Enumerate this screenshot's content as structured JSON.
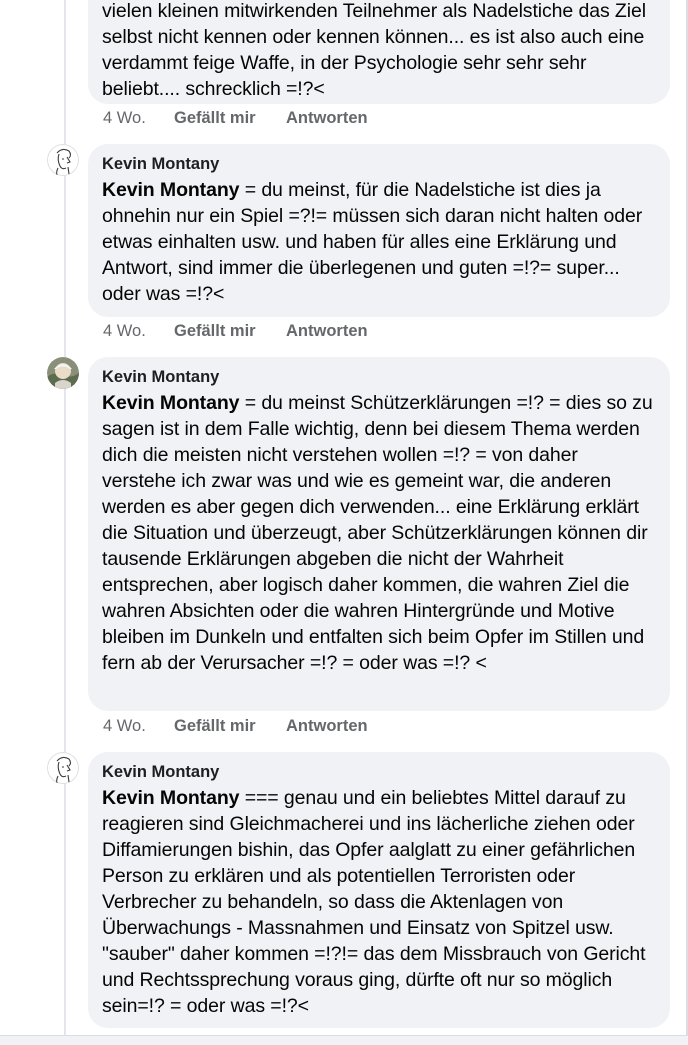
{
  "comments": [
    {
      "author": "",
      "text": "vielen kleinen  mitwirkenden Teilnehmer als Nadelstiche das Ziel selbst nicht kennen oder kennen können... es ist also auch eine verdammt feige Waffe, in der Psychologie sehr sehr sehr  beliebt.... schrecklich =!?<",
      "time": "4 Wo.",
      "like": "Gefällt mir",
      "reply": "Antworten"
    },
    {
      "author": "Kevin Montany",
      "avatar": "sketch-face-icon",
      "mention": "Kevin Montany",
      "text": " = du meinst, für die Nadelstiche ist dies ja ohnehin nur ein Spiel =?!= müssen sich daran nicht halten oder etwas einhalten usw. und haben für alles eine Erklärung und Antwort, sind immer die überlegenen und guten =!?= super... oder was =!?<",
      "time": "4 Wo.",
      "like": "Gefällt mir",
      "reply": "Antworten"
    },
    {
      "author": "Kevin Montany",
      "avatar": "photo-avatar-icon",
      "mention": "Kevin Montany",
      "text": " = du meinst Schützerklärungen =!? = dies so zu sagen ist in dem Falle wichtig, denn bei diesem Thema werden dich die meisten nicht verstehen wollen =!? = von daher verstehe ich zwar was und wie es gemeint war, die anderen werden es aber gegen dich verwenden... eine Erklärung erklärt die Situation und überzeugt, aber Schützerklärungen können  dir tausende Erklärungen abgeben die nicht der Wahrheit entsprechen, aber logisch daher kommen, die wahren Ziel die wahren Absichten oder die wahren Hintergründe und Motive bleiben im Dunkeln und entfalten sich beim Opfer im Stillen und fern ab der Verursacher =!? = oder was =!? <",
      "time": "4 Wo.",
      "like": "Gefällt mir",
      "reply": "Antworten"
    },
    {
      "author": "Kevin Montany",
      "avatar": "sketch-face-icon",
      "mention": "Kevin Montany",
      "text": " === genau und ein beliebtes Mittel darauf zu reagieren sind Gleichmacherei und ins lächerliche ziehen oder Diffamierungen bishin, das Opfer aalglatt zu einer gefährlichen Person zu erklären und als potentiellen Terroristen oder Verbrecher zu behandeln, so dass die Aktenlagen von Überwachungs - Massnahmen und Einsatz von Spitzel usw. \"sauber\" daher kommen =!?!= das dem Missbrauch von Gericht und Rechtssprechung voraus ging, dürfte oft nur so möglich sein=!? = oder was =!?<",
      "time": "4 Wo.",
      "like": "Gefällt mir",
      "reply": "Antworten"
    }
  ]
}
